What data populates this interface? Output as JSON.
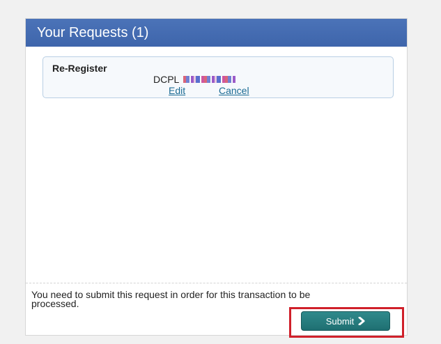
{
  "panel": {
    "title": "Your Requests (1)"
  },
  "request": {
    "type": "Re-Register",
    "item_prefix": "DCPL",
    "edit_label": "Edit",
    "cancel_label": "Cancel"
  },
  "footer": {
    "notice": "You need to submit this request in order for this transaction to be processed.",
    "submit_label": "Submit"
  },
  "icons": {
    "submit_icon": "chevron-right-icon"
  },
  "colors": {
    "header": "#4169b0",
    "link": "#1b6b94",
    "submit": "#267b7e",
    "highlight": "#d0202a"
  }
}
